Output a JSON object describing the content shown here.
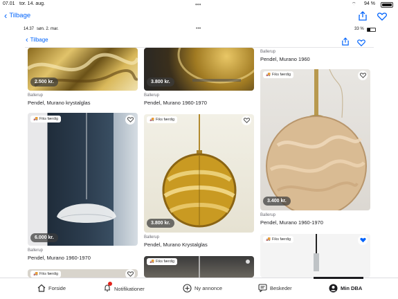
{
  "outer_status": {
    "time": "07.01",
    "date": "tor. 14. aug.",
    "battery": "94 %"
  },
  "outer_nav": {
    "back_label": "Tilbage"
  },
  "inner_status": {
    "time": "14.37",
    "date": "søn. 2. mar.",
    "battery": "33 %"
  },
  "inner_nav": {
    "back_label": "Tilbage"
  },
  "col3_top": {
    "location": "Ballerup",
    "title": "Pendel, Murano 1960"
  },
  "cards": [
    {
      "price": "2.500 kr.",
      "location": "Ballerup",
      "title": "Pendel, Murano krystalglas"
    },
    {
      "price": "3.800 kr.",
      "location": "Ballerup",
      "title": "Pendel, Murano 1960-1970"
    },
    {
      "badge": "Fiks færdig",
      "price": "6.000 kr.",
      "location": "Ballerup",
      "title": "Pendel, Murano 1960-1970"
    },
    {
      "badge": "Fiks færdig",
      "price": "3.800 kr.",
      "location": "Ballerup",
      "title": "Pendel, Murano Krystalglas"
    },
    {
      "badge": "Fiks færdig",
      "price": "3.400 kr.",
      "location": "Ballerup",
      "title": "Pendel, Murano 1960-1970"
    },
    {
      "badge": "Fiks færdig"
    },
    {
      "badge": "Fiks færdig"
    },
    {
      "badge": "Fiks færdig"
    }
  ],
  "tabbar": {
    "items": [
      {
        "label": "Forside",
        "icon": "home-icon"
      },
      {
        "label": "Notifikationer",
        "icon": "bell-icon"
      },
      {
        "label": "Ny annonce",
        "icon": "plus-circle-icon"
      },
      {
        "label": "Beskeder",
        "icon": "chat-icon"
      },
      {
        "label": "Min DBA",
        "icon": "profile-icon"
      }
    ]
  },
  "colors": {
    "accent": "#0063fb",
    "heart_filled": "#0063fb"
  }
}
